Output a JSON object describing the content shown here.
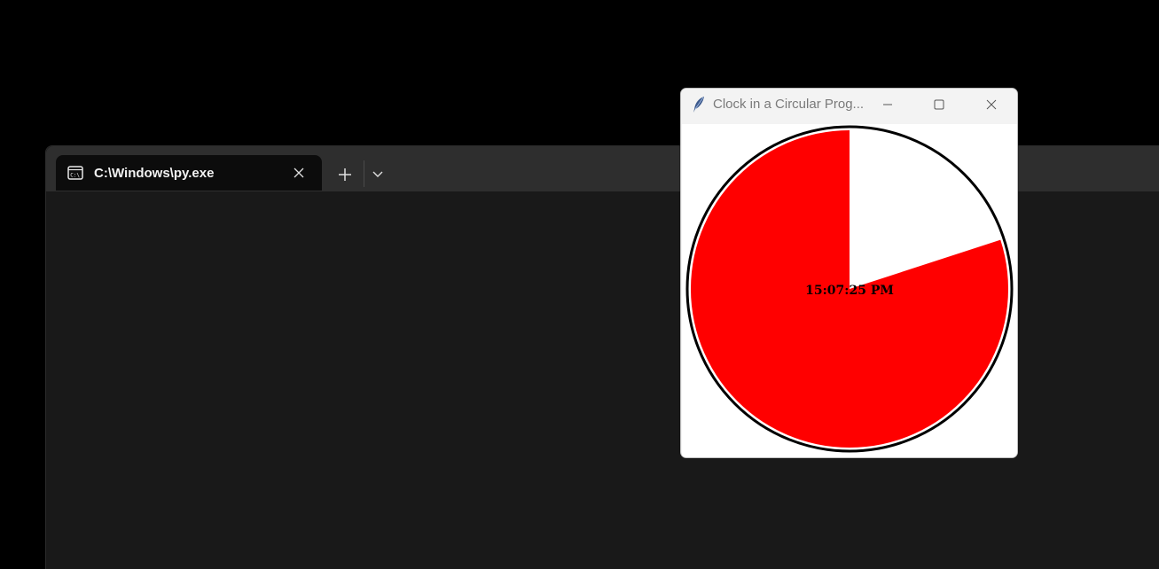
{
  "terminal": {
    "tab_title": "C:\\Windows\\py.exe",
    "tab_icon": "console-icon",
    "close_icon": "close-icon",
    "new_tab_icon": "plus-icon",
    "dropdown_icon": "chevron-down-icon",
    "background": "#191919",
    "titlebar_color": "#2e2e2e"
  },
  "tk_window": {
    "title": "Clock in a Circular Prog...",
    "app_icon": "feather-icon",
    "minimize_icon": "minimize-icon",
    "maximize_icon": "maximize-icon",
    "close_icon": "close-icon"
  },
  "clock": {
    "time_text": "15:07:25 PM",
    "progress_fraction": 0.8,
    "fill_color": "#ff0000",
    "ring_color": "#000000",
    "background": "#ffffff"
  }
}
